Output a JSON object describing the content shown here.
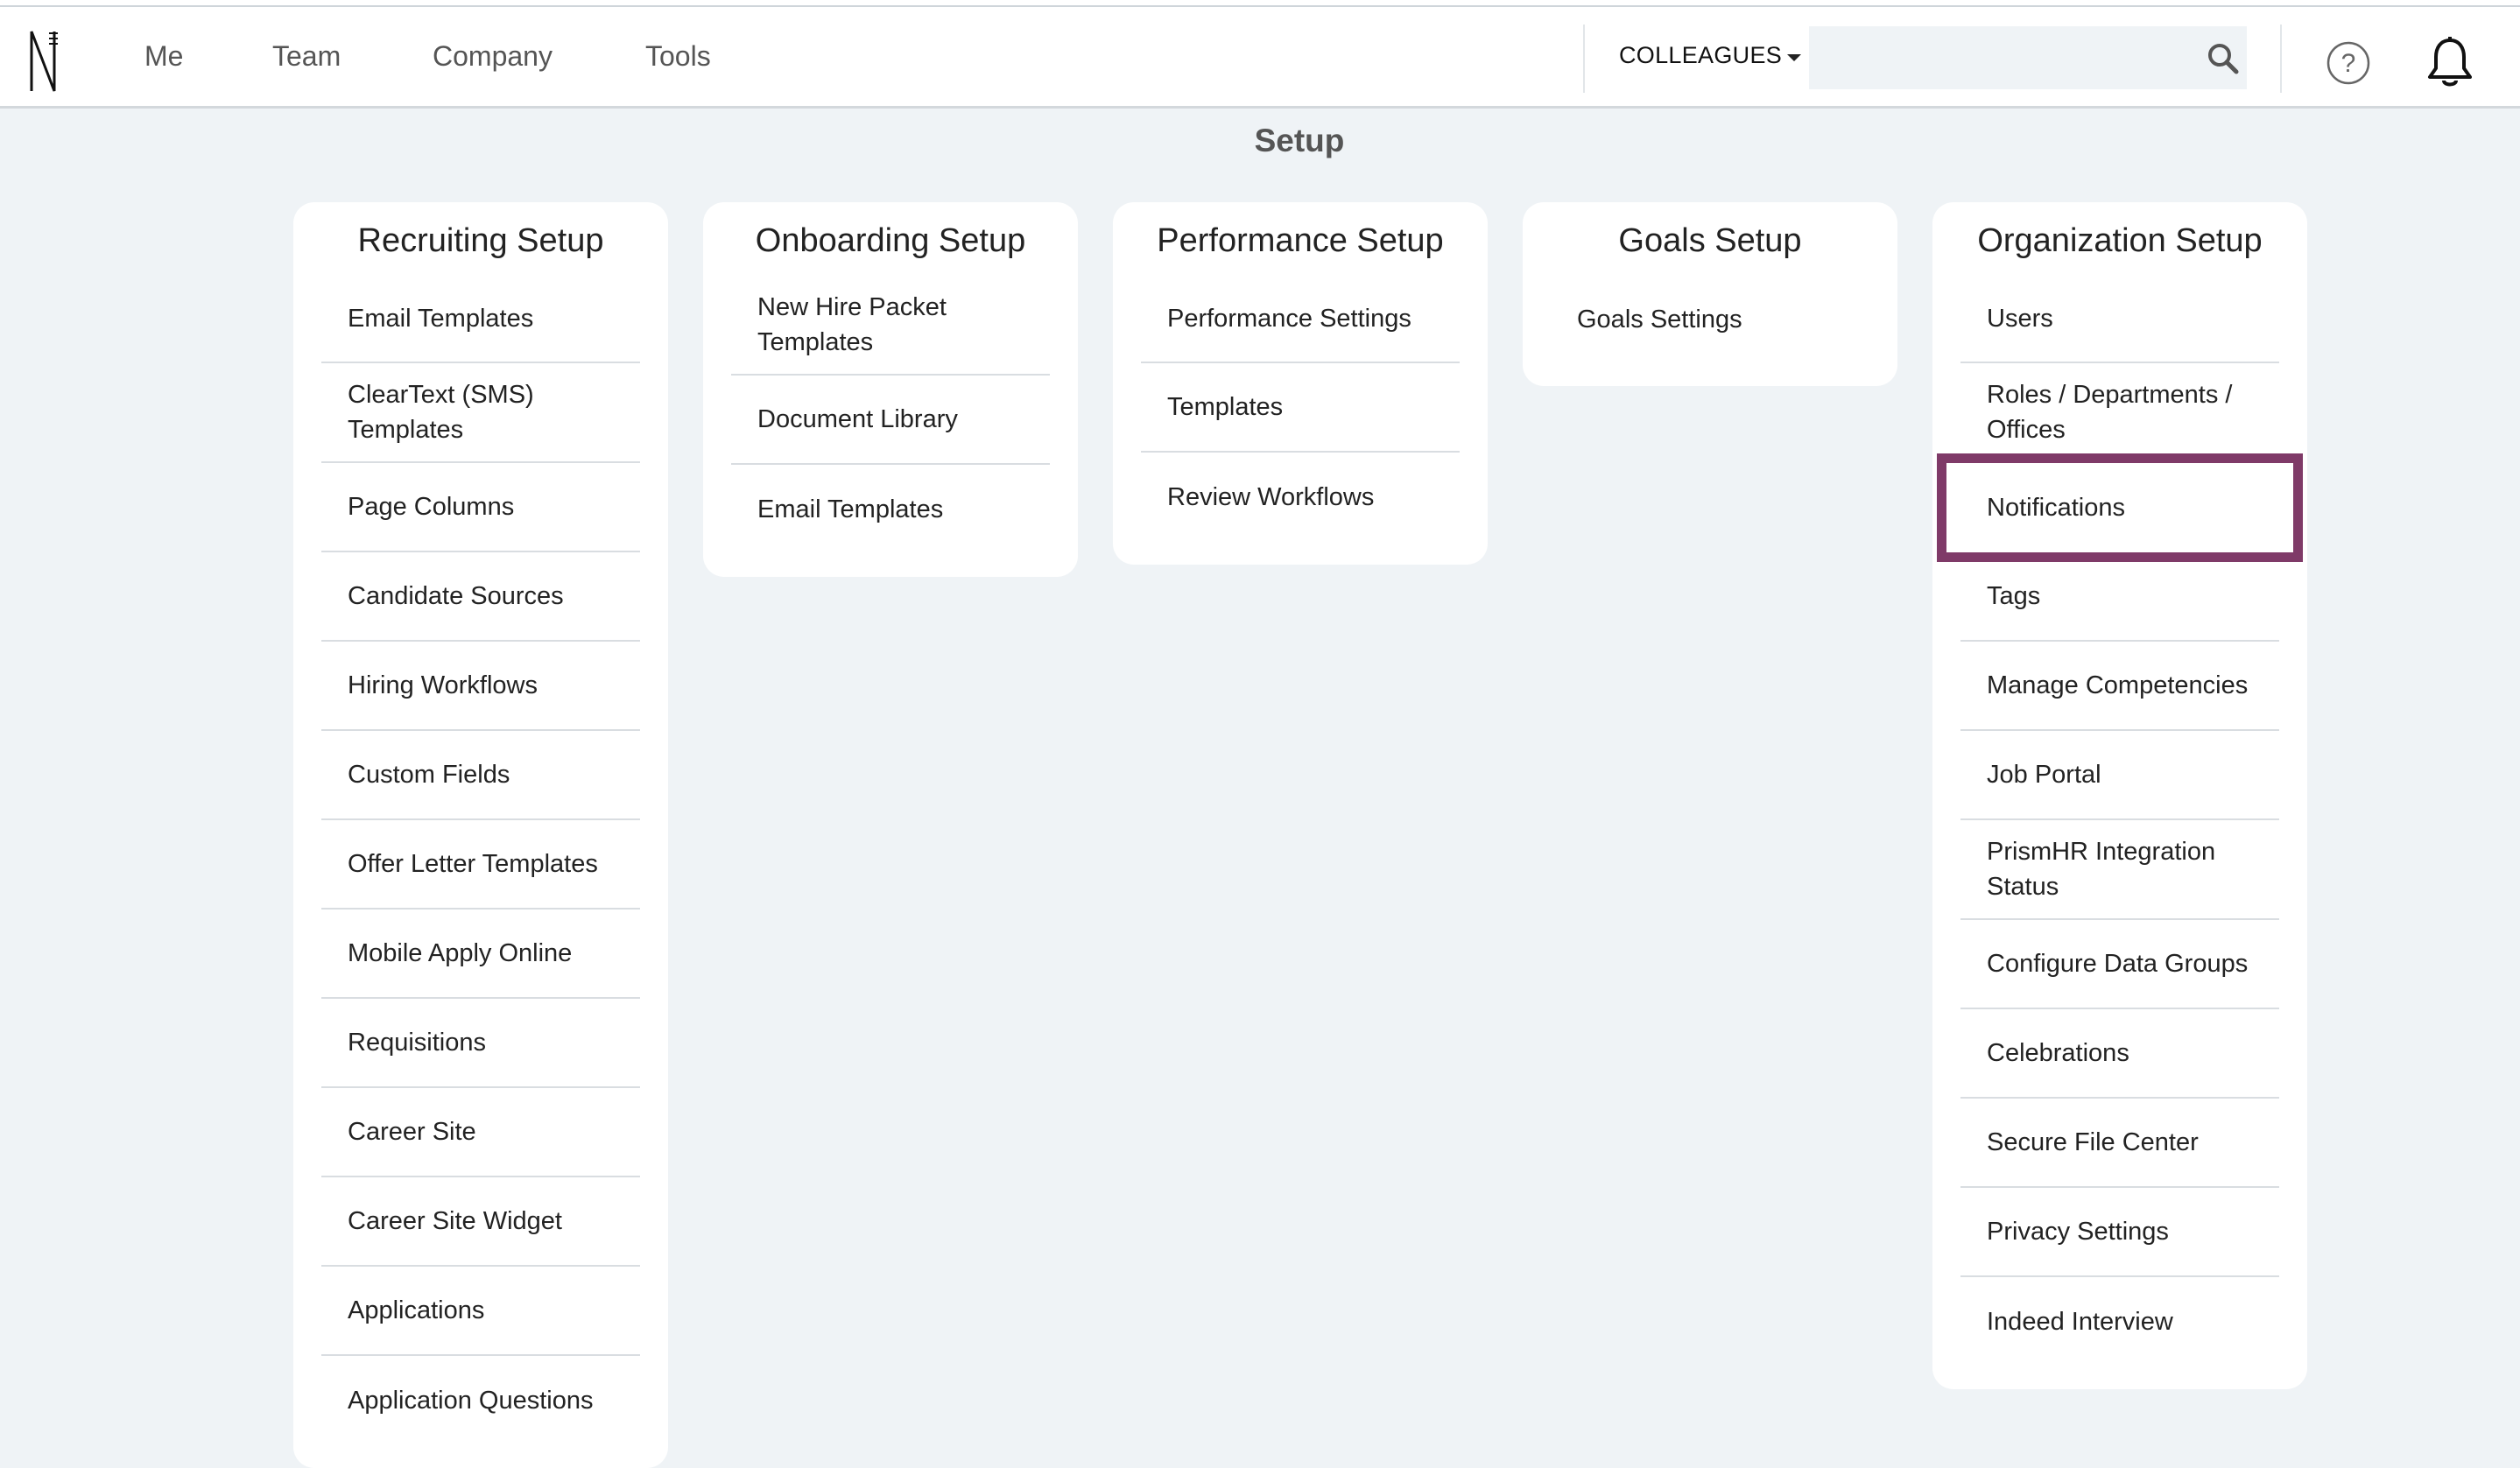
{
  "nav": {
    "links": [
      "Me",
      "Team",
      "Company",
      "Tools"
    ],
    "colleagues_label": "COLLEAGUES",
    "search_value": ""
  },
  "page": {
    "title": "Setup"
  },
  "cards": [
    {
      "title": "Recruiting Setup",
      "items": [
        "Email Templates",
        "ClearText (SMS) Templates",
        "Page Columns",
        "Candidate Sources",
        "Hiring Workflows",
        "Custom Fields",
        "Offer Letter Templates",
        "Mobile Apply Online",
        "Requisitions",
        "Career Site",
        "Career Site Widget",
        "Applications",
        "Application Questions"
      ]
    },
    {
      "title": "Onboarding Setup",
      "items": [
        "New Hire Packet Templates",
        "Document Library",
        "Email Templates"
      ]
    },
    {
      "title": "Performance Setup",
      "items": [
        "Performance Settings",
        "Templates",
        "Review Workflows"
      ]
    },
    {
      "title": "Goals Setup",
      "items": [
        "Goals Settings"
      ]
    },
    {
      "title": "Organization Setup",
      "items": [
        "Users",
        "Roles / Departments / Offices",
        "Notifications",
        "Tags",
        "Manage Competencies",
        "Job Portal",
        "PrismHR Integration Status",
        "Configure Data Groups",
        "Celebrations",
        "Secure File Center",
        "Privacy Settings",
        "Indeed Interview"
      ]
    }
  ],
  "highlight": {
    "card": 4,
    "item": 2,
    "color": "#7f3a68"
  },
  "colors": {
    "background": "#eff3f6",
    "card": "#ffffff",
    "text": "#222222"
  }
}
